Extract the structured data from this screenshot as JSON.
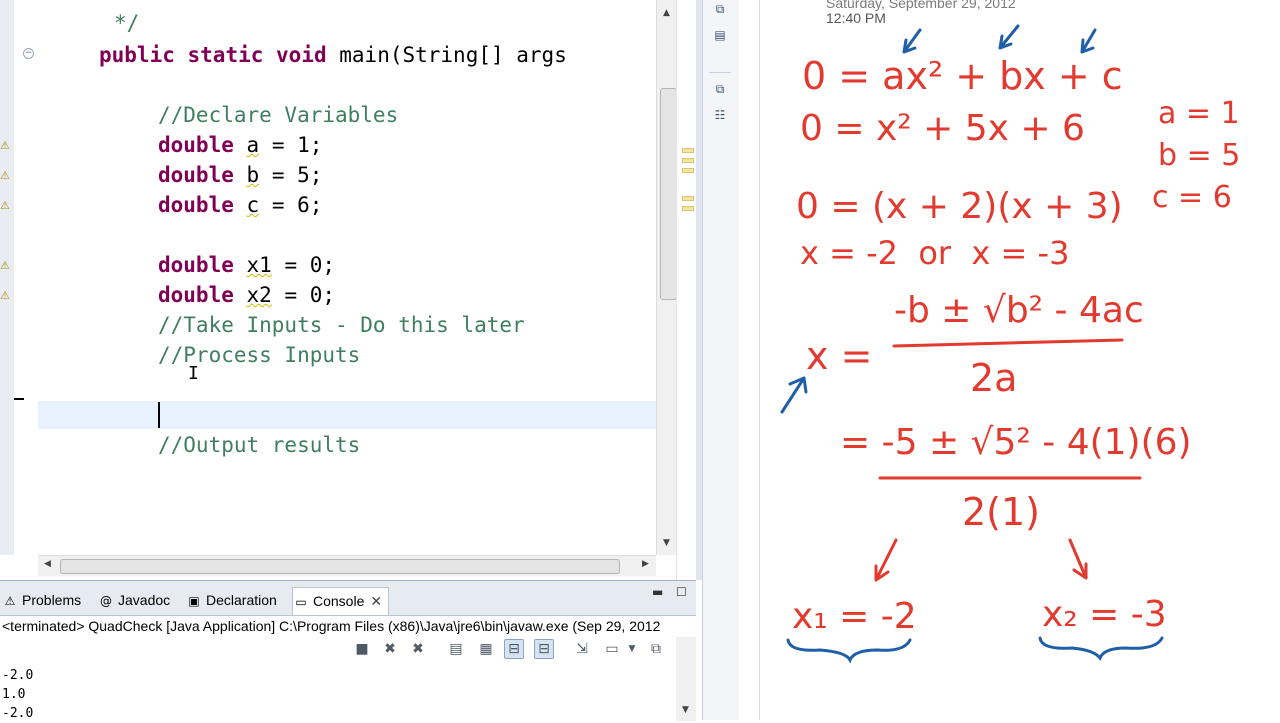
{
  "editor": {
    "lines": {
      "comment_end": "*/",
      "main_sig": "public static void main(String[] args",
      "c_declare": "//Declare Variables",
      "a_value": "1",
      "b_value": "5",
      "c_value": "6",
      "x1_value": "0",
      "x2_value": "0",
      "c_take_inputs": "//Take Inputs - Do this later",
      "c_process": "//Process Inputs",
      "c_output": "//Output results"
    },
    "tokens": {
      "kw_public": "public",
      "kw_static": "static",
      "kw_void": "void",
      "kw_double": "double",
      "var_a": "a",
      "var_b": "b",
      "var_c": "c",
      "var_x1": "x1",
      "var_x2": "x2"
    }
  },
  "panel": {
    "tabs": [
      {
        "label": "Problems",
        "icon": "problems-icon"
      },
      {
        "label": "Javadoc",
        "icon": "at-icon"
      },
      {
        "label": "Declaration",
        "icon": "declaration-icon"
      },
      {
        "label": "Console",
        "icon": "console-icon"
      }
    ],
    "console_header": "<terminated> QuadCheck [Java Application] C:\\Program Files (x86)\\Java\\jre6\\bin\\javaw.exe (Sep 29, 2012",
    "output": [
      "-2.0",
      "1.0",
      "-2.0"
    ]
  },
  "notes": {
    "date": "Saturday, September 29, 2012",
    "time": "12:40 PM",
    "eq1": "0 = ax² + bx + c",
    "eq2": "0 = x² + 5x + 6",
    "coef_a": "a = 1",
    "coef_b": "b = 5",
    "coef_c": "c = 6",
    "eq3": "0 = (x + 2)(x + 3)",
    "eq4": "x = -2  or  x = -3",
    "qf_lhs": "x =",
    "qf_num": "-b ± √b² - 4ac",
    "qf_den": "2a",
    "sub_num": "= -5 ± √5² - 4(1)(6)",
    "sub_den": "2(1)",
    "x1_result": "x₁ = -2",
    "x2_result": "x₂ = -3"
  }
}
